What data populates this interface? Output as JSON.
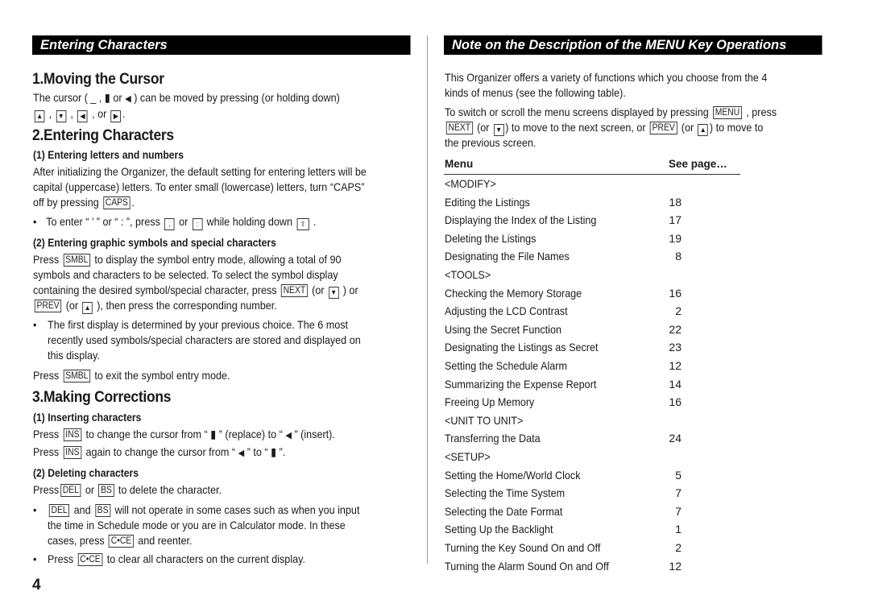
{
  "left": {
    "header": "Entering Characters",
    "sec1": {
      "title": "1.Moving the Cursor",
      "line1_a": "The cursor ( _ , ",
      "line1_b": " or ",
      "line1_c": " ) can be moved by pressing (or holding down)",
      "line2_sep1": " , ",
      "line2_sep2": " , ",
      "line2_sep3": " , or ",
      "line2_end": "."
    },
    "sec2": {
      "title": "2.Entering Characters",
      "sub1": "(1)  Entering letters and numbers",
      "p1_l1": "After initializing the Organizer, the default setting for entering letters will be",
      "p1_l2": "capital (uppercase) letters. To enter small (lowercase) letters, turn “CAPS”",
      "p1_l3": "off by pressing ",
      "p1_l3_end": ".",
      "bullet1_a": "To enter “ ’ ” or “ : ”, press ",
      "bullet1_b": " or ",
      "bullet1_c": " while holding down ",
      "bullet1_d": " .",
      "sub2": "(2)  Entering graphic symbols and special characters",
      "p2_l1a": "Press ",
      "p2_l1b": " to display the symbol entry mode, allowing a total of 90",
      "p2_l2": "symbols and characters to be selected. To select the symbol display",
      "p2_l3a": "containing the desired symbol/special character, press ",
      "p2_l3b": " (or ",
      "p2_l3c": " ) or",
      "p2_l4a": " (or ",
      "p2_l4b": " ), then press the corresponding number.",
      "bullet2_l1": "The first display is determined by your previous choice. The 6 most",
      "bullet2_l2": "recently used symbols/special characters are stored and displayed on",
      "bullet2_l3": "this display.",
      "p3a": "Press ",
      "p3b": " to exit the symbol entry mode."
    },
    "sec3": {
      "title": "3.Making Corrections",
      "sub1": "(1)  Inserting characters",
      "ins_l1a": "Press ",
      "ins_l1b": " to change the cursor from “ ",
      "ins_l1c": " ” (replace) to “ ",
      "ins_l1d": " ” (insert).",
      "ins_l2a": "Press ",
      "ins_l2b": " again to change the cursor from “ ",
      "ins_l2c": " ” to “ ",
      "ins_l2d": " ”.",
      "sub2": "(2)  Deleting characters",
      "del_a": "Press",
      "del_b": " or ",
      "del_c": " to delete the character.",
      "b1_l1a": " and ",
      "b1_l1b": " will not operate in some cases such as when you input",
      "b1_l2": "the time in Schedule mode or you are in Calculator mode. In these",
      "b1_l3a": "cases, press ",
      "b1_l3b": " and reenter.",
      "b2a": "Press ",
      "b2b": " to clear all characters on the current display."
    },
    "page_number": "4"
  },
  "keys": {
    "caps": "CAPS",
    "smbl": "SMBL",
    "next": "NEXT",
    "prev": "PREV",
    "ins": "INS",
    "del": "DEL",
    "bs": "BS",
    "cce": "C•CE",
    "menu": "MENU",
    "up": "▲",
    "down": "▼",
    "left": "◀",
    "right": "▶",
    "comma": ",",
    "colon": ":",
    "shift": "⇧"
  },
  "glyphs": {
    "block": "▮",
    "insert": "◀",
    "bullet": "•"
  },
  "right": {
    "header": "Note on the Description of the MENU Key Operations",
    "p1_l1": "This Organizer offers a variety of functions which you choose from the 4",
    "p1_l2": "kinds of menus (see the following table).",
    "p2_l1a": "To switch or scroll the menu screens displayed by pressing ",
    "p2_l1b": " , press",
    "p2_l2a": " (or ",
    "p2_l2b": ") to move to the next screen, or ",
    "p2_l2c": " (or ",
    "p2_l2d": ") to move to",
    "p2_l3": "the previous screen.",
    "table": {
      "col_menu": "Menu",
      "col_page": "See page…",
      "rows": [
        {
          "label": "<MODIFY>",
          "page": ""
        },
        {
          "label": "Editing the Listings",
          "page": "18"
        },
        {
          "label": "Displaying the Index of the Listing",
          "page": "17"
        },
        {
          "label": "Deleting the Listings",
          "page": "19"
        },
        {
          "label": "Designating the File Names",
          "page": "8"
        },
        {
          "label": "<TOOLS>",
          "page": ""
        },
        {
          "label": "Checking the Memory Storage",
          "page": "16"
        },
        {
          "label": "Adjusting the LCD Contrast",
          "page": "2"
        },
        {
          "label": "Using the Secret Function",
          "page": "22"
        },
        {
          "label": "Designating the Listings as Secret",
          "page": "23"
        },
        {
          "label": "Setting the Schedule Alarm",
          "page": "12"
        },
        {
          "label": "Summarizing the Expense Report",
          "page": "14"
        },
        {
          "label": "Freeing Up Memory",
          "page": "16"
        },
        {
          "label": "<UNIT TO UNIT>",
          "page": ""
        },
        {
          "label": "Transferring the Data",
          "page": "24"
        },
        {
          "label": "<SETUP>",
          "page": ""
        },
        {
          "label": "Setting the Home/World Clock",
          "page": "5"
        },
        {
          "label": "Selecting the Time System",
          "page": "7"
        },
        {
          "label": "Selecting the Date Format",
          "page": "7"
        },
        {
          "label": "Setting Up the Backlight",
          "page": "1"
        },
        {
          "label": "Turning the Key Sound On and Off",
          "page": "2"
        },
        {
          "label": "Turning the Alarm Sound On and Off",
          "page": "12"
        }
      ]
    }
  }
}
